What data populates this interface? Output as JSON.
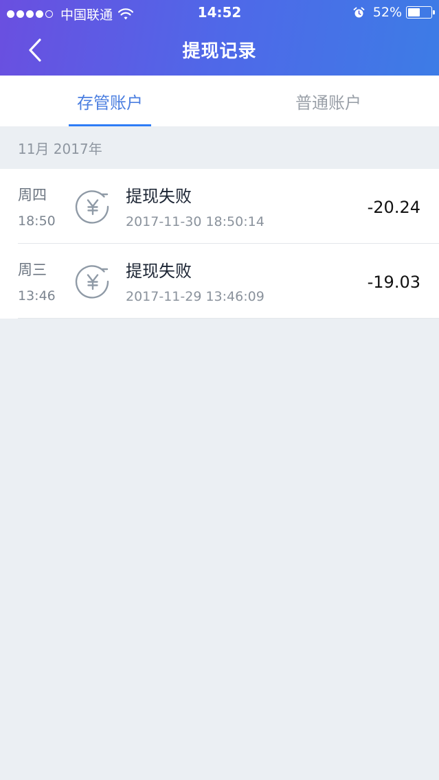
{
  "status_bar": {
    "carrier": "中国联通",
    "time": "14:52",
    "battery_percent": "52%",
    "battery_level": 0.52,
    "signal_bars": 4
  },
  "nav": {
    "title": "提现记录",
    "back_icon": "chevron-left-icon"
  },
  "tabs": [
    {
      "label": "存管账户",
      "active": true
    },
    {
      "label": "普通账户",
      "active": false
    }
  ],
  "month_header": "11月 2017年",
  "records": [
    {
      "day": "周四",
      "time": "18:50",
      "title": "提现失败",
      "datetime": "2017-11-30 18:50:14",
      "amount": "-20.24",
      "icon": "yuan-refund-icon"
    },
    {
      "day": "周三",
      "time": "13:46",
      "title": "提现失败",
      "datetime": "2017-11-29 13:46:09",
      "amount": "-19.03",
      "icon": "yuan-refund-icon"
    }
  ],
  "colors": {
    "header_gradient_start": "#6a4fe0",
    "header_gradient_end": "#3d7ce6",
    "tab_active": "#4a7ee0",
    "tab_underline": "#2e7cf6",
    "background": "#ebeff3"
  }
}
